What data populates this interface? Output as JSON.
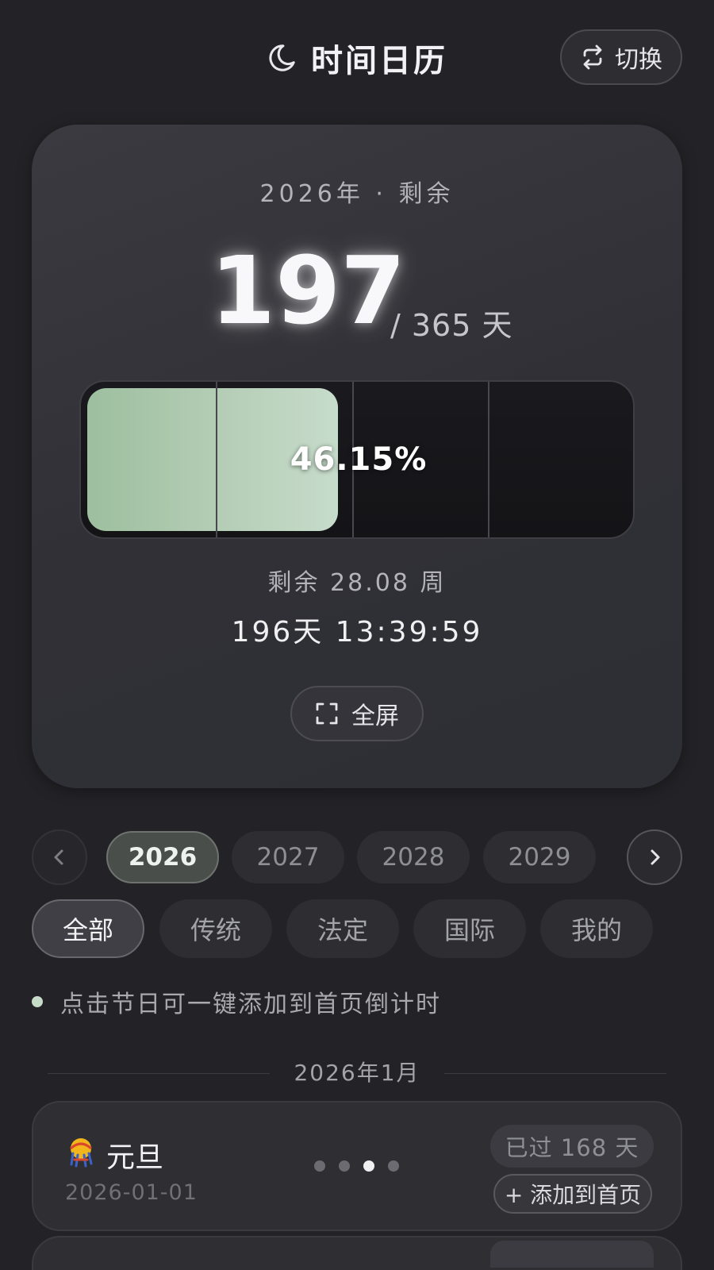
{
  "header": {
    "title": "时间日历",
    "moon_icon": "moon-icon",
    "switch_label": "切换",
    "switch_icon": "swap-icon"
  },
  "summary": {
    "year_label": "2026年 · 剩余",
    "remaining_days": "197",
    "total_days_label": "/ 365 天",
    "progress_percent_label": "46.15%",
    "progress_fraction": 0.4615,
    "weeks_remaining_label": "剩余 28.08 周",
    "countdown_label": "196天 13:39:59",
    "fullscreen_label": "全屏",
    "fullscreen_icon": "fullscreen-icon",
    "progress_fill_color": "#b3ccb4"
  },
  "years": {
    "items": [
      "2026",
      "2027",
      "2028",
      "2029"
    ],
    "selected": "2026"
  },
  "filters": {
    "items": [
      "全部",
      "传统",
      "法定",
      "国际",
      "我的"
    ],
    "selected": "全部"
  },
  "hint": "点击节日可一键添加到首页倒计时",
  "month_header": "2026年1月",
  "holidays": [
    {
      "name": "元旦",
      "date": "2026-01-01",
      "status": "已过 168 天",
      "add_label": "+ 添加到首页",
      "icon": "new-year-emoji-icon"
    }
  ],
  "pager": {
    "count": 4,
    "active_index": 2
  }
}
